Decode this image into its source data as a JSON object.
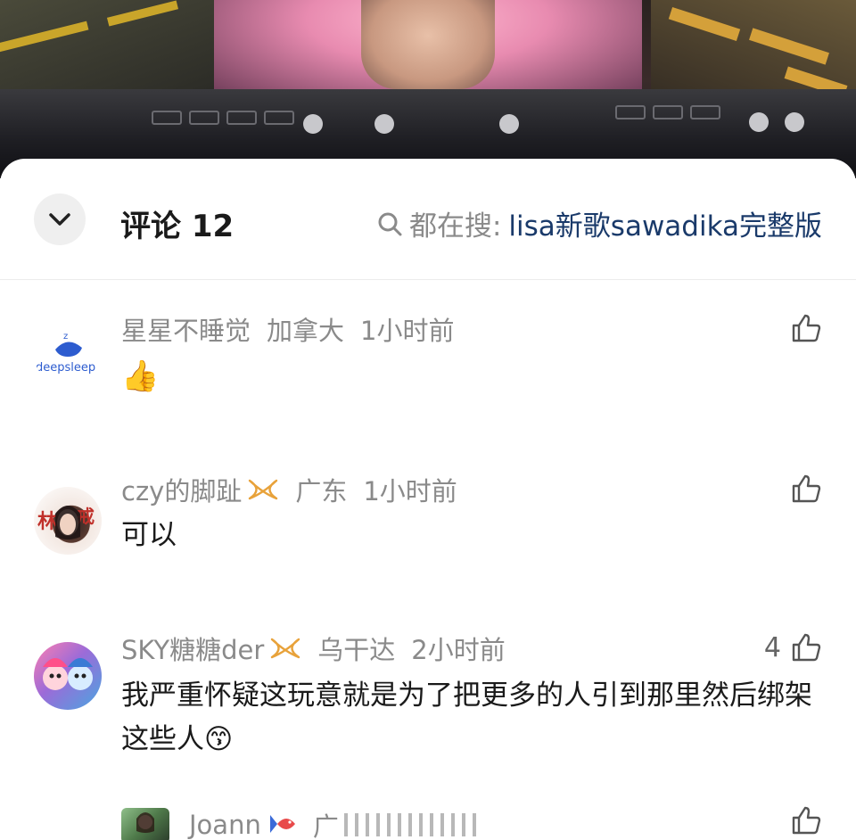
{
  "header": {
    "title": "评论 12",
    "search_prefix": "都在搜:",
    "search_term": "lisa新歌sawadika完整版"
  },
  "comments": [
    {
      "username": "星星不睡觉",
      "location": "加拿大",
      "time": "1小时前",
      "avatar_text": "deepsleep",
      "content_emoji": "👍",
      "likes": ""
    },
    {
      "username": "czy的脚趾",
      "location": "广东",
      "time": "1小时前",
      "content": "可以",
      "likes": ""
    },
    {
      "username": "SKY糖糖der",
      "location": "乌干达",
      "time": "2小时前",
      "content": "我严重怀疑这玩意就是为了把更多的人引到那里然后绑架这些人",
      "content_emoji": "😙",
      "likes": "4"
    },
    {
      "username": "Joann",
      "location": "广",
      "likes": ""
    }
  ],
  "colors": {
    "meta_gray": "#8a8a8a",
    "search_term": "#1a3a6a",
    "badge_gold": "#e8a23a"
  }
}
